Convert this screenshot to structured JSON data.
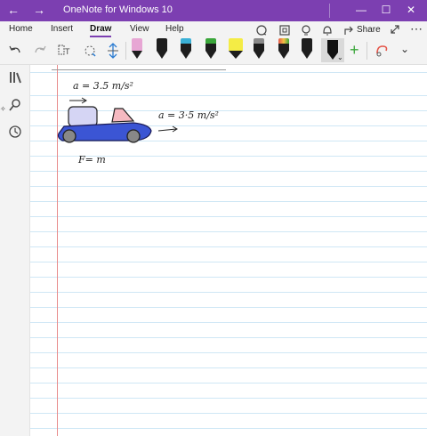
{
  "titlebar": {
    "title": "OneNote for Windows 10",
    "back": "←",
    "forward": "→",
    "minimize": "—",
    "maximize": "☐",
    "close": "✕"
  },
  "ribbon": {
    "tabs": [
      "Home",
      "Insert",
      "Draw",
      "View",
      "Help"
    ],
    "active_tab": "Draw",
    "share": "Share"
  },
  "pens": [
    {
      "name": "pen-pink",
      "color": "#e7a6d4"
    },
    {
      "name": "pen-black-1",
      "color": "#1d1d1d"
    },
    {
      "name": "pen-cyan",
      "color": "#3ab0d6"
    },
    {
      "name": "pen-green",
      "color": "#3aa63a"
    },
    {
      "name": "highlighter-yellow",
      "color": "#f4ec45"
    },
    {
      "name": "pen-black-2",
      "color": "#1d1d1d"
    },
    {
      "name": "pen-multicolor",
      "color": "#e5564a"
    },
    {
      "name": "pen-black-3",
      "color": "#1d1d1d"
    }
  ],
  "ink": {
    "eq1": "a = 3.5 m/s²",
    "eq2": "a = 3·5 m/s²",
    "eq3": "F= m"
  },
  "colors": {
    "accent": "#7c3fb1",
    "margin_line": "#e88b8b",
    "rule_line": "#cfe7f5",
    "truck_body": "#3b55d4",
    "cabin": "#d5d5f4",
    "window": "#f5b9c1"
  }
}
